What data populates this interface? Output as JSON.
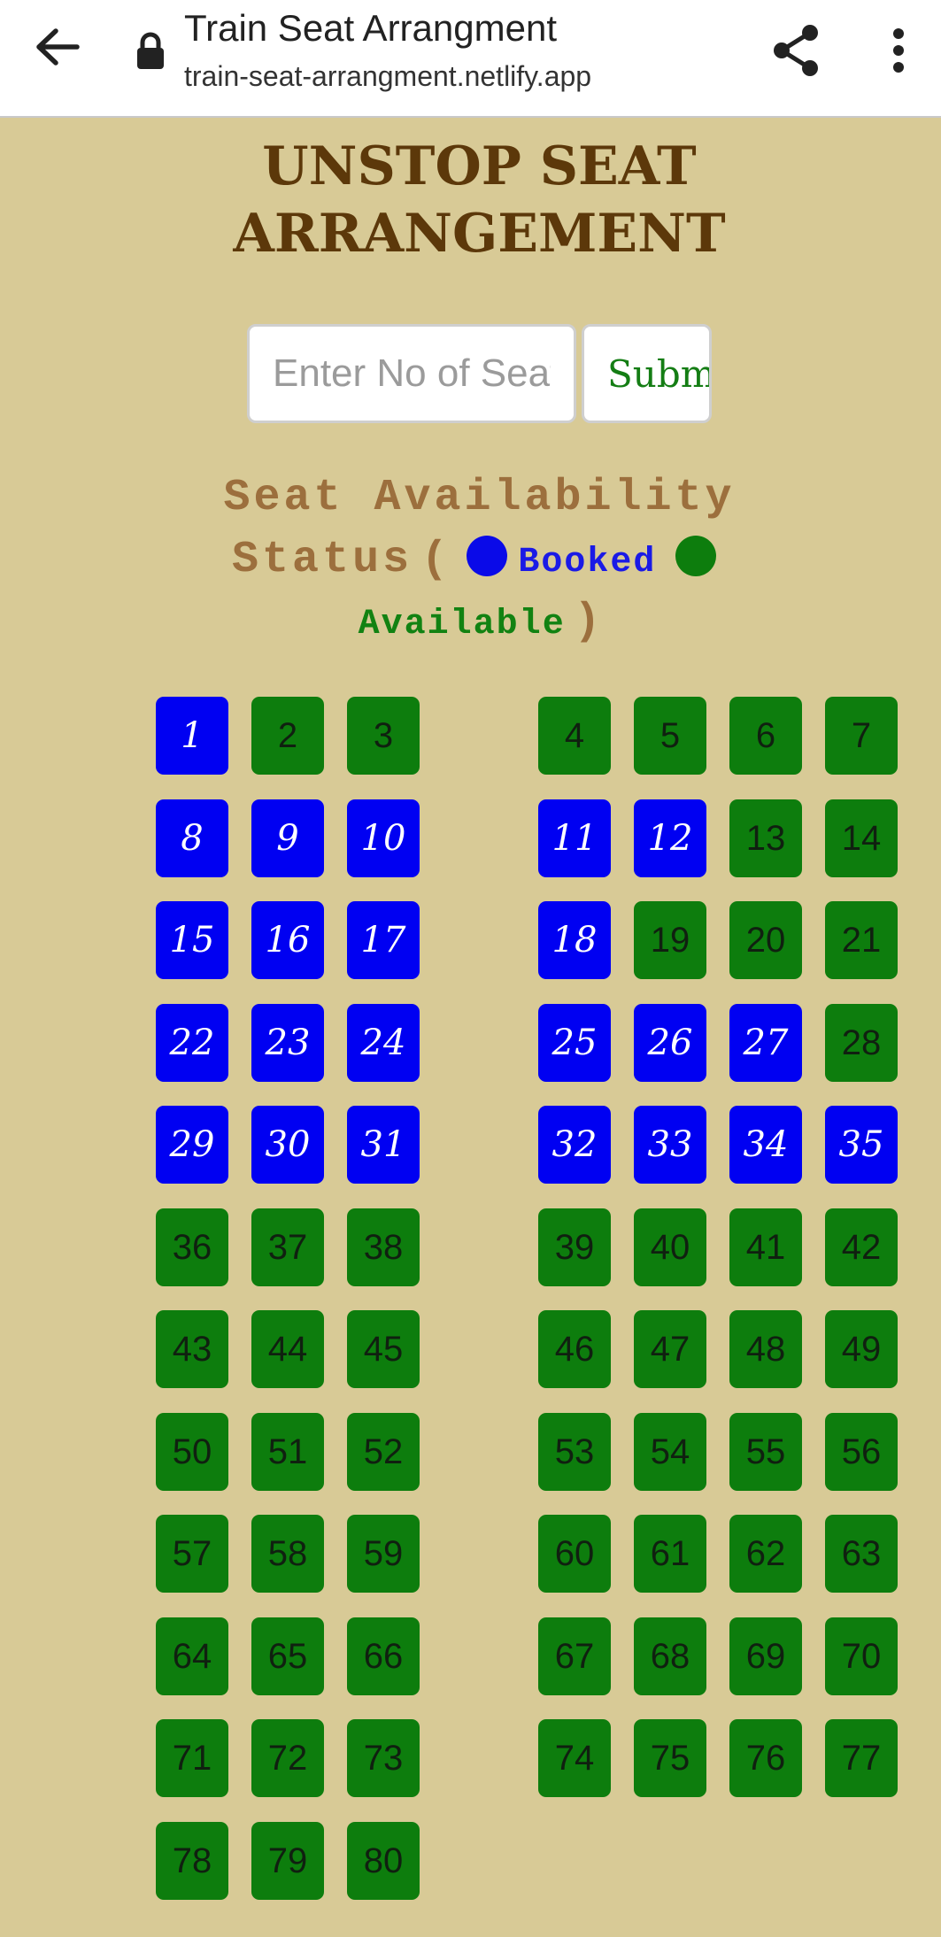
{
  "browser": {
    "title": "Train Seat Arrangment",
    "url": "train-seat-arrangment.netlify.app",
    "back_icon": "back-arrow-icon",
    "lock_icon": "lock-icon",
    "share_icon": "share-icon",
    "menu_icon": "more-vertical-icon"
  },
  "page": {
    "title_line1": "UNSTOP SEAT",
    "title_line2": "ARRANGEMENT",
    "input_placeholder": "Enter No of Seats",
    "submit_label": "Submit"
  },
  "status": {
    "label_line1": "Seat Availability",
    "label_line2": "Status",
    "open_paren": "(",
    "close_paren": ")",
    "booked_label": "Booked",
    "available_label": "Available",
    "booked_color": "#0000f2",
    "available_color": "#0d7d0d"
  },
  "seats": {
    "booked": [
      "1",
      "8",
      "9",
      "10",
      "11",
      "12",
      "15",
      "16",
      "17",
      "18",
      "22",
      "23",
      "24",
      "25",
      "26",
      "27",
      "29",
      "30",
      "31",
      "32",
      "33",
      "34",
      "35"
    ],
    "rows": [
      [
        "1",
        "2",
        "3",
        "4",
        "5",
        "6",
        "7"
      ],
      [
        "8",
        "9",
        "10",
        "11",
        "12",
        "13",
        "14"
      ],
      [
        "15",
        "16",
        "17",
        "18",
        "19",
        "20",
        "21"
      ],
      [
        "22",
        "23",
        "24",
        "25",
        "26",
        "27",
        "28"
      ],
      [
        "29",
        "30",
        "31",
        "32",
        "33",
        "34",
        "35"
      ],
      [
        "36",
        "37",
        "38",
        "39",
        "40",
        "41",
        "42"
      ],
      [
        "43",
        "44",
        "45",
        "46",
        "47",
        "48",
        "49"
      ],
      [
        "50",
        "51",
        "52",
        "53",
        "54",
        "55",
        "56"
      ],
      [
        "57",
        "58",
        "59",
        "60",
        "61",
        "62",
        "63"
      ],
      [
        "64",
        "65",
        "66",
        "67",
        "68",
        "69",
        "70"
      ],
      [
        "71",
        "72",
        "73",
        "74",
        "75",
        "76",
        "77"
      ],
      [
        "78",
        "79",
        "80"
      ]
    ]
  }
}
